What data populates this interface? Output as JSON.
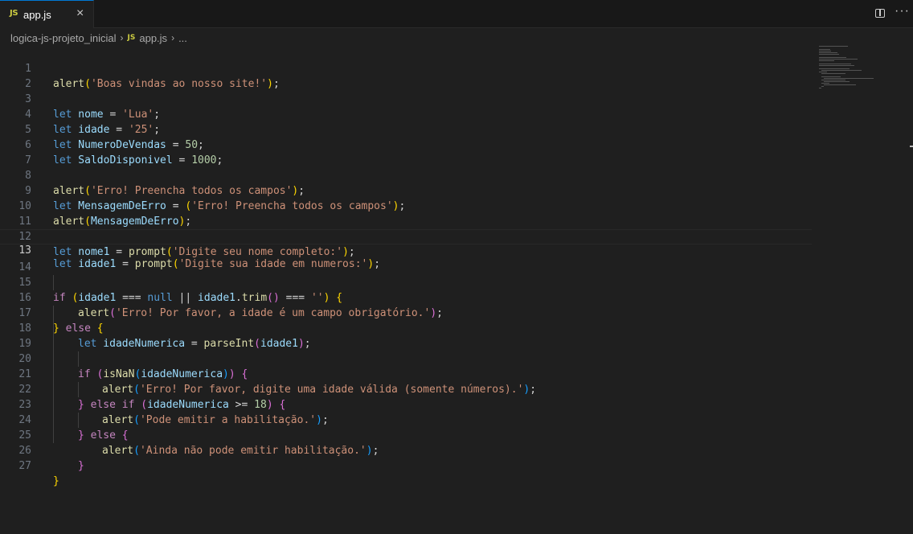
{
  "tab": {
    "lang_badge": "JS",
    "filename": "app.js",
    "close_glyph": "×"
  },
  "toolbar": {
    "split_icon": "split-editor-icon",
    "more_glyph": "···"
  },
  "breadcrumb": {
    "folder": "logica-js-projeto_inicial",
    "lang_badge": "JS",
    "file": "app.js",
    "ellipsis": "..."
  },
  "colors": {
    "keyword": "#569cd6",
    "control": "#c586c0",
    "function": "#dcdcaa",
    "variable": "#9cdcfe",
    "string": "#ce9178",
    "number": "#b5cea8",
    "accent": "#0078d4"
  },
  "editor": {
    "current_line": 13,
    "lines": [
      {
        "n": "1"
      },
      {
        "n": "2"
      },
      {
        "n": "3"
      },
      {
        "n": "4"
      },
      {
        "n": "5"
      },
      {
        "n": "6"
      },
      {
        "n": "7"
      },
      {
        "n": "8"
      },
      {
        "n": "9"
      },
      {
        "n": "10"
      },
      {
        "n": "11"
      },
      {
        "n": "12"
      },
      {
        "n": "13"
      },
      {
        "n": "14"
      },
      {
        "n": "15"
      },
      {
        "n": "16"
      },
      {
        "n": "17"
      },
      {
        "n": "18"
      },
      {
        "n": "19"
      },
      {
        "n": "20"
      },
      {
        "n": "21"
      },
      {
        "n": "22"
      },
      {
        "n": "23"
      },
      {
        "n": "24"
      },
      {
        "n": "25"
      },
      {
        "n": "26"
      },
      {
        "n": "27"
      }
    ],
    "tokens": {
      "l1": [
        "alert",
        "(",
        "'Boas vindas ao nosso site!'",
        ")",
        ";"
      ],
      "l3": [
        "let",
        " nome",
        " = ",
        "'Lua'",
        ";"
      ],
      "l4": [
        "let",
        " idade",
        " = ",
        "'25'",
        ";"
      ],
      "l5": [
        "let",
        " NumeroDeVendas",
        " = ",
        "50",
        ";"
      ],
      "l6": [
        "let",
        " SaldoDisponivel",
        " = ",
        "1000",
        ";"
      ],
      "l8": [
        "alert",
        "(",
        "'Erro! Preencha todos os campos'",
        ")",
        ";"
      ],
      "l9": [
        "let",
        " MensagemDeErro",
        " = ",
        "(",
        "'Erro! Preencha todos os campos'",
        ")",
        ";"
      ],
      "l10": [
        "alert",
        "(",
        "MensagemDeErro",
        ")",
        ";"
      ],
      "l12": [
        "let",
        " nome1",
        " = ",
        "prompt",
        "(",
        "'Digite seu nome completo:'",
        ")",
        ";"
      ],
      "l13": [
        "let",
        " idade1",
        " = ",
        "prompt",
        "(",
        "'Digite sua idade em numeros:'",
        ")",
        ";"
      ],
      "l15": [
        "if",
        " ",
        "(",
        "idade1",
        " === ",
        "null",
        " || ",
        "idade1",
        ".",
        "trim",
        "(",
        ")",
        " === ",
        "''",
        ")",
        " ",
        "{"
      ],
      "l16": [
        "alert",
        "(",
        "'Erro! Por favor, a idade é um campo obrigatório.'",
        ")",
        ";"
      ],
      "l17": [
        "}",
        " else ",
        "{"
      ],
      "l18": [
        "let",
        " idadeNumerica",
        " = ",
        "parseInt",
        "(",
        "idade1",
        ")",
        ";"
      ],
      "l20": [
        "if",
        " ",
        "(",
        "isNaN",
        "(",
        "idadeNumerica",
        ")",
        ")",
        " ",
        "{"
      ],
      "l21": [
        "alert",
        "(",
        "'Erro! Por favor, digite uma idade válida (somente números).'",
        ")",
        ";"
      ],
      "l22": [
        "}",
        " else if ",
        "(",
        "idadeNumerica",
        " >= ",
        "18",
        ")",
        " ",
        "{"
      ],
      "l23": [
        "alert",
        "(",
        "'Pode emitir a habilitação.'",
        ")",
        ";"
      ],
      "l24": [
        "}",
        " else ",
        "{"
      ],
      "l25": [
        "alert",
        "(",
        "'Ainda não pode emitir habilitação.'",
        ")",
        ";"
      ],
      "l26": [
        "}"
      ],
      "l27": [
        "}"
      ]
    }
  }
}
